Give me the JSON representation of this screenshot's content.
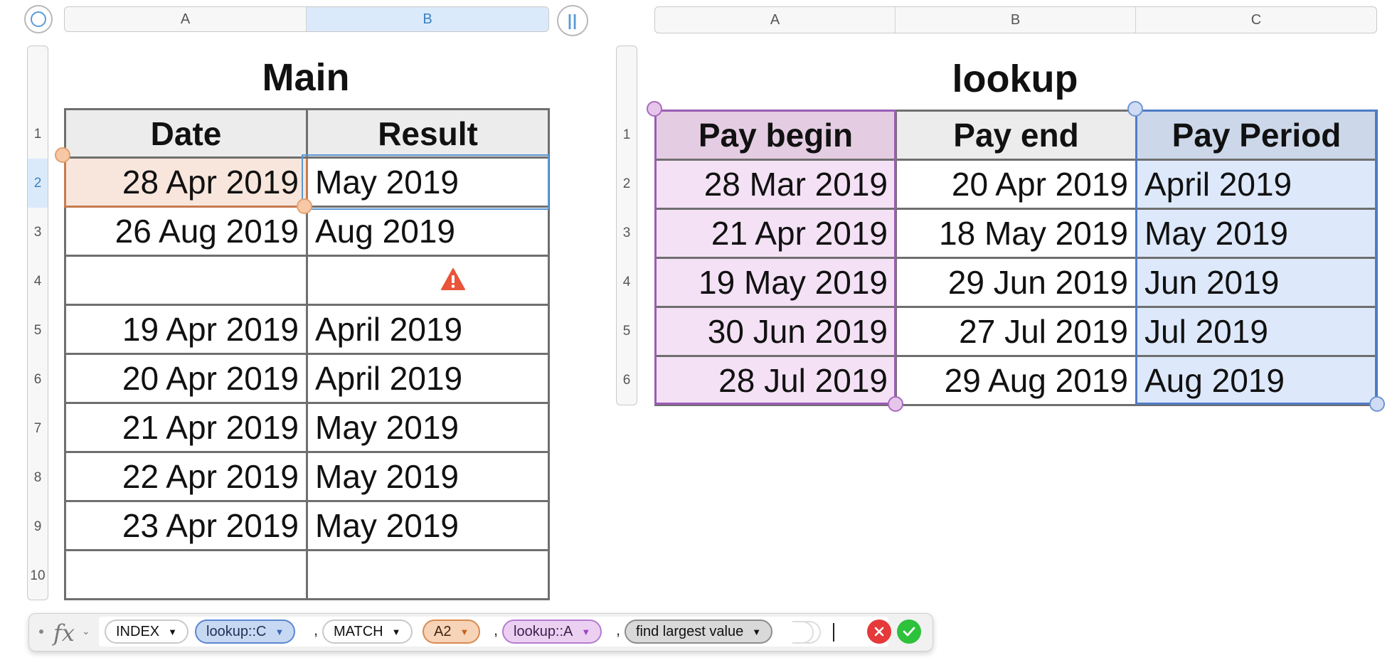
{
  "main_sheet": {
    "title": "Main",
    "column_letters": [
      "A",
      "B"
    ],
    "selected_column": "B",
    "row_numbers": [
      "1",
      "2",
      "3",
      "4",
      "5",
      "6",
      "7",
      "8",
      "9",
      "10"
    ],
    "selected_row": "2",
    "headers": [
      "Date",
      "Result"
    ],
    "rows": [
      {
        "date": "28 Apr 2019",
        "result": "May 2019"
      },
      {
        "date": "26 Aug 2019",
        "result": "Aug 2019"
      },
      {
        "date": "",
        "result": "",
        "warning": true
      },
      {
        "date": "19 Apr 2019",
        "result": "April 2019"
      },
      {
        "date": "20 Apr 2019",
        "result": "April 2019"
      },
      {
        "date": "21 Apr 2019",
        "result": "May 2019"
      },
      {
        "date": "22 Apr 2019",
        "result": "May 2019"
      },
      {
        "date": "23 Apr 2019",
        "result": "May 2019"
      },
      {
        "date": "",
        "result": ""
      }
    ]
  },
  "lookup_sheet": {
    "title": "lookup",
    "column_letters": [
      "A",
      "B",
      "C"
    ],
    "row_numbers": [
      "1",
      "2",
      "3",
      "4",
      "5",
      "6"
    ],
    "headers": [
      "Pay begin",
      "Pay end",
      "Pay Period"
    ],
    "rows": [
      {
        "begin": "28 Mar 2019",
        "end": "20 Apr 2019",
        "period": "April 2019"
      },
      {
        "begin": "21 Apr 2019",
        "end": "18 May 2019",
        "period": "May 2019"
      },
      {
        "begin": "19 May 2019",
        "end": "29 Jun 2019",
        "period": "Jun 2019"
      },
      {
        "begin": "30 Jun 2019",
        "end": "27 Jul 2019",
        "period": "Jul 2019"
      },
      {
        "begin": "28 Jul 2019",
        "end": "29 Aug 2019",
        "period": "Aug 2019"
      }
    ]
  },
  "formula_bar": {
    "fx_label": "fx",
    "tokens": [
      {
        "label": "INDEX",
        "kind": "function"
      },
      {
        "label": "lookup::C",
        "kind": "ref-blue"
      },
      {
        "label": "MATCH",
        "kind": "function"
      },
      {
        "label": "A2",
        "kind": "ref-orange"
      },
      {
        "label": "lookup::A",
        "kind": "ref-purple"
      },
      {
        "label": "find largest value",
        "kind": "option"
      }
    ],
    "separator": ","
  },
  "colors": {
    "selection_blue": "#3b82c4",
    "ref_orange": "#f2b07a",
    "ref_purple": "#b57bd0",
    "ref_blue": "#5b86d1",
    "cancel_red": "#e5393a",
    "accept_green": "#2ec13b",
    "warning_red": "#e9543a"
  },
  "icons": {
    "select_all_left": "circle-select-icon",
    "freeze_toggle": "pause-bars-icon",
    "warning": "warning-triangle-icon",
    "cancel": "cancel-x-icon",
    "accept": "checkmark-icon",
    "dropdown": "dropdown-triangle-icon"
  }
}
